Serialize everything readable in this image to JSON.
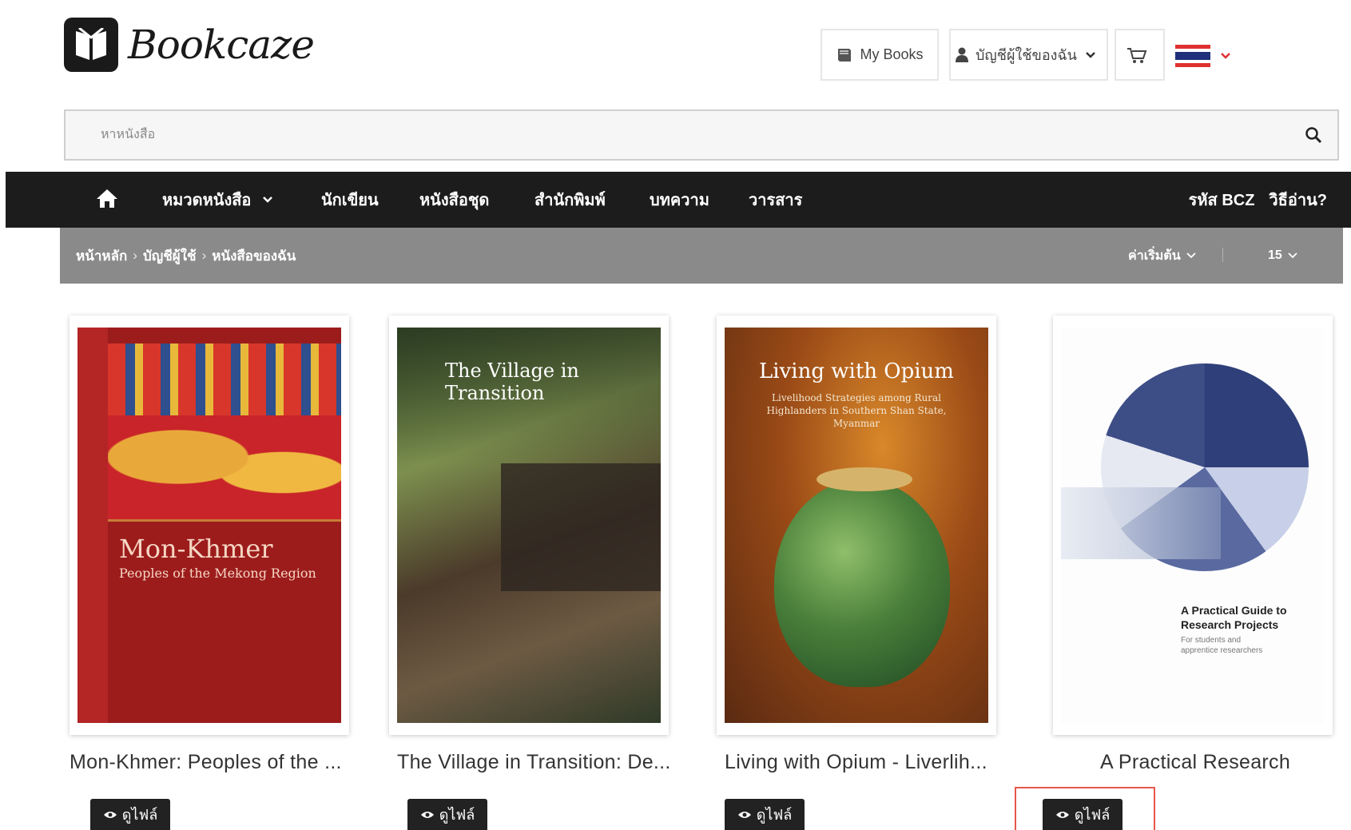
{
  "header": {
    "logo_text": "Bookcaze",
    "mybooks_label": "My Books",
    "account_label": "บัญชีผู้ใช้ของฉัน",
    "language": "Thai"
  },
  "search": {
    "placeholder": "หาหนังสือ"
  },
  "nav": {
    "items": [
      {
        "label": "หมวดหนังสือ",
        "dropdown": true
      },
      {
        "label": "นักเขียน"
      },
      {
        "label": "หนังสือชุด"
      },
      {
        "label": "สำนักพิมพ์"
      },
      {
        "label": "บทความ"
      },
      {
        "label": "วารสาร"
      }
    ],
    "code_label": "รหัส BCZ",
    "howto_label": "วิธีอ่าน?"
  },
  "breadcrumb": [
    "หน้าหลัก",
    "บัญชีผู้ใช้",
    "หนังสือของฉัน"
  ],
  "sort": {
    "order_label": "ค่าเริ่มต้น",
    "per_page": "15"
  },
  "books": [
    {
      "title": "Mon-Khmer: Peoples of the ...",
      "cover_title": "Mon-Khmer",
      "cover_subtitle": "Peoples of the Mekong Region",
      "view_label": "ดูไฟล์"
    },
    {
      "title": "The Village in Transition: De...",
      "cover_title": "The Village in Transition",
      "view_label": "ดูไฟล์"
    },
    {
      "title": "Living with Opium - Liverlih...",
      "cover_title": "Living with Opium",
      "cover_subtitle": "Livelihood Strategies among Rural Highlanders in Southern Shan State, Myanmar",
      "view_label": "ดูไฟล์"
    },
    {
      "title": "A Practical Research",
      "cover_title": "A Practical Guide to Research Projects",
      "cover_subtitle": "For students and apprentice researchers",
      "view_label": "ดูไฟล์"
    }
  ],
  "colors": {
    "nav_bg": "#1c1c1c",
    "crumb_bg": "#8a8a8a",
    "highlight": "#e8574a"
  }
}
